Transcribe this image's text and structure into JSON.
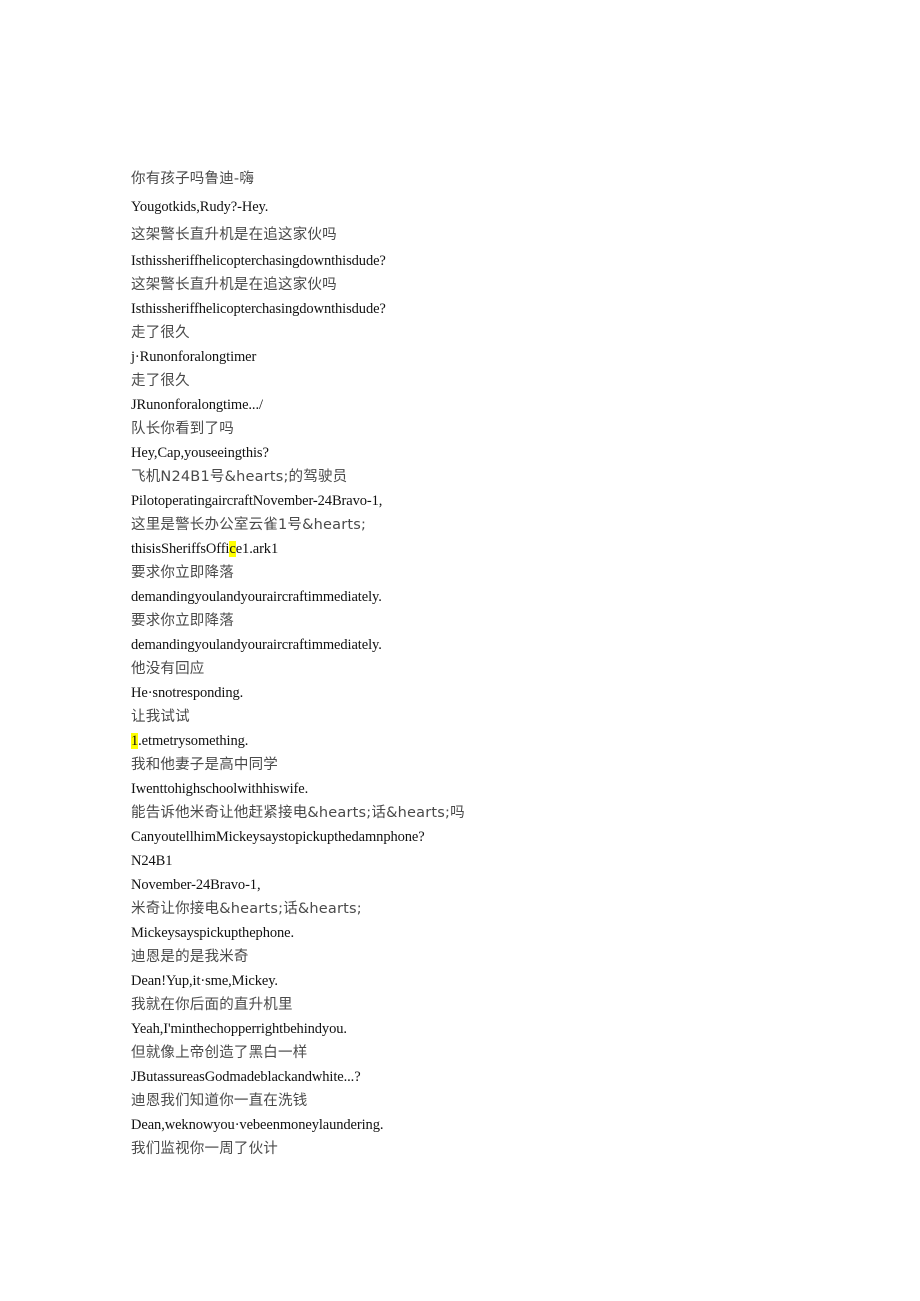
{
  "document": {
    "background_color": "#ffffff",
    "zh_text_color": "#4a4a4a",
    "en_text_color": "#111111",
    "highlight_color": "#ffff00",
    "lines": [
      {
        "lang": "zh",
        "text": "你有孩子吗鲁迪-嗨",
        "lead_gap": true
      },
      {
        "lang": "en",
        "text": "Yougotkids,Rudy?-Hey.",
        "lead_gap": true
      },
      {
        "lang": "zh",
        "text": "这架警长直升机是在追这家伙吗",
        "lead_gap": true
      },
      {
        "lang": "en",
        "text": "Isthissheriffhelicopterchasingdownthisdude?"
      },
      {
        "lang": "zh",
        "text": "这架警长直升机是在追这家伙吗"
      },
      {
        "lang": "en",
        "text": "Isthissheriffhelicopterchasingdownthisdude?"
      },
      {
        "lang": "zh",
        "text": "走了很久"
      },
      {
        "lang": "en",
        "text": "j·Runonforalongtimer"
      },
      {
        "lang": "zh",
        "text": "走了很久"
      },
      {
        "lang": "en",
        "text": "JRunonforalongtime.../"
      },
      {
        "lang": "zh",
        "text": "队长你看到了吗"
      },
      {
        "lang": "en",
        "text": "Hey,Cap,youseeingthis?"
      },
      {
        "lang": "zh",
        "text": "飞机N24B1号&hearts;的驾驶员"
      },
      {
        "lang": "en",
        "text": "PilotoperatingaircraftNovember-24Bravo-1,"
      },
      {
        "lang": "zh",
        "text": "这里是警长办公室云雀1号&hearts;"
      },
      {
        "lang": "en",
        "text": "thisisSheriffsOffice1.ark1",
        "highlight": "1",
        "highlight_at": 18
      },
      {
        "lang": "zh",
        "text": "要求你立即降落"
      },
      {
        "lang": "en",
        "text": "demandingyoulandyouraircraftimmediately."
      },
      {
        "lang": "zh",
        "text": "要求你立即降落"
      },
      {
        "lang": "en",
        "text": "demandingyoulandyouraircraftimmediately."
      },
      {
        "lang": "zh",
        "text": "他没有回应"
      },
      {
        "lang": "en",
        "text": "He·snotresponding."
      },
      {
        "lang": "zh",
        "text": "让我试试"
      },
      {
        "lang": "en",
        "text": "1.etmetrysomething.",
        "highlight": "1",
        "highlight_at": 0
      },
      {
        "lang": "zh",
        "text": "我和他妻子是高中同学"
      },
      {
        "lang": "en",
        "text": "Iwenttohighschoolwithhiswife."
      },
      {
        "lang": "zh",
        "text": "能告诉他米奇让他赶紧接电&hearts;话&hearts;吗"
      },
      {
        "lang": "en",
        "text": "CanyoutellhimMickeysaystopickupthedamnphone?"
      },
      {
        "lang": "en",
        "text": "N24B1"
      },
      {
        "lang": "en",
        "text": "November-24Bravo-1,"
      },
      {
        "lang": "zh",
        "text": "米奇让你接电&hearts;话&hearts;"
      },
      {
        "lang": "en",
        "text": "Mickeysayspickupthephone."
      },
      {
        "lang": "zh",
        "text": "迪恩是的是我米奇"
      },
      {
        "lang": "en",
        "text": "Dean!Yup,it·sme,Mickey."
      },
      {
        "lang": "zh",
        "text": "我就在你后面的直升机里"
      },
      {
        "lang": "en",
        "text": "Yeah,I'minthechopperrightbehindyou."
      },
      {
        "lang": "zh",
        "text": "但就像上帝创造了黑白一样"
      },
      {
        "lang": "en",
        "text": "JButassureasGodmadeblackandwhite...?"
      },
      {
        "lang": "zh",
        "text": "迪恩我们知道你一直在洗钱"
      },
      {
        "lang": "en",
        "text": "Dean,weknowyou·vebeenmoneylaundering."
      },
      {
        "lang": "zh",
        "text": "我们监视你一周了伙计"
      }
    ]
  }
}
